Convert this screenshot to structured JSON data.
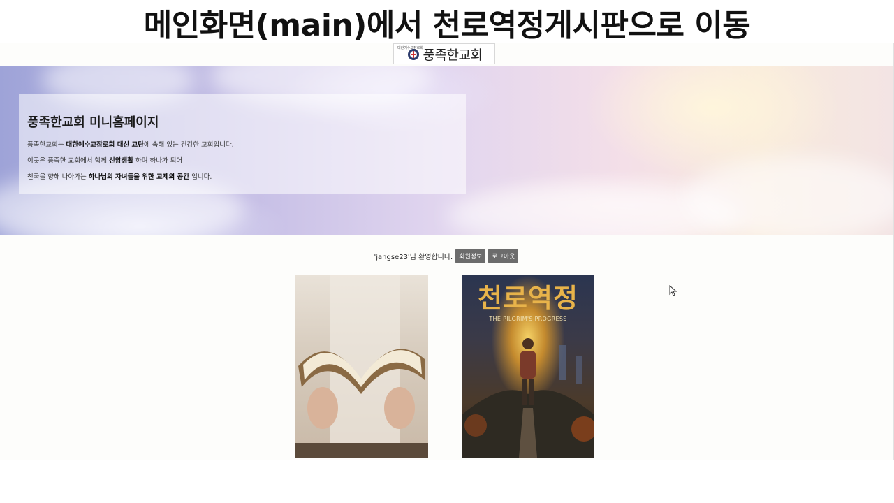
{
  "slide": {
    "title": "메인화면(main)에서 천로역정게시판으로 이동"
  },
  "header": {
    "logo_small_text": "대한예수교장로회",
    "logo_text": "풍족한교회"
  },
  "hero": {
    "title": "풍족한교회 미니홈페이지",
    "line1": {
      "pre": "풍족한교회는 ",
      "bold": "대한예수교장로회 대신 교단",
      "post": "에 속해 있는 건강한 교회입니다."
    },
    "line2": {
      "pre": "이곳은 풍족한 교회에서 함께 ",
      "bold": "신앙생활",
      "post": " 하며 하나가 되어"
    },
    "line3": {
      "pre": "천국을 향해 나아가는 ",
      "bold": "하나님의 자녀들을 위한 교제의 공간",
      "post": " 입니다."
    }
  },
  "welcome": {
    "text": "'jangse23'님 환영합니다.",
    "member_info_label": "회원정보",
    "logout_label": "로그아웃"
  },
  "cards": {
    "pilgrim_title": "천로역정",
    "pilgrim_subtitle": "THE PILGRIM'S PROGRESS"
  },
  "colors": {
    "button_bg": "#6c6c6c",
    "title_color": "#111111",
    "pilgrim_gold": "#e8b34a"
  }
}
